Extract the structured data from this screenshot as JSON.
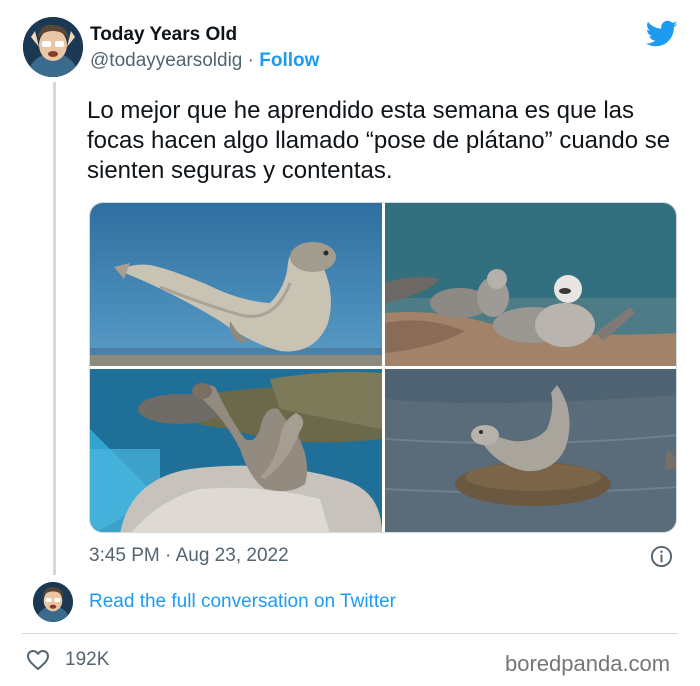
{
  "author": {
    "name": "Today Years Old",
    "handle": "@todayyearsoldig",
    "separator": " · ",
    "follow_label": "Follow"
  },
  "tweet": {
    "text": "Lo mejor que he aprendido esta semana es que las focas hacen algo llamado “pose de plátano” cuando se sienten seguras y contentas.",
    "timestamp": "3:45 PM · Aug 23, 2022",
    "read_link": "Read the full conversation on Twitter",
    "likes": "192K"
  },
  "media": {
    "count": 4,
    "image_subjects": [
      "seal-banana-pose-beach",
      "seals-group-rocks",
      "seals-on-rock-water",
      "seal-on-rock-in-water"
    ]
  },
  "icons": [
    "twitter-bird-icon",
    "info-icon",
    "heart-icon"
  ],
  "watermark": "boredpanda.com",
  "colors": {
    "accent": "#1d9bf0",
    "text_primary": "#0f1419",
    "text_secondary": "#536471",
    "border": "#cfd9de"
  }
}
